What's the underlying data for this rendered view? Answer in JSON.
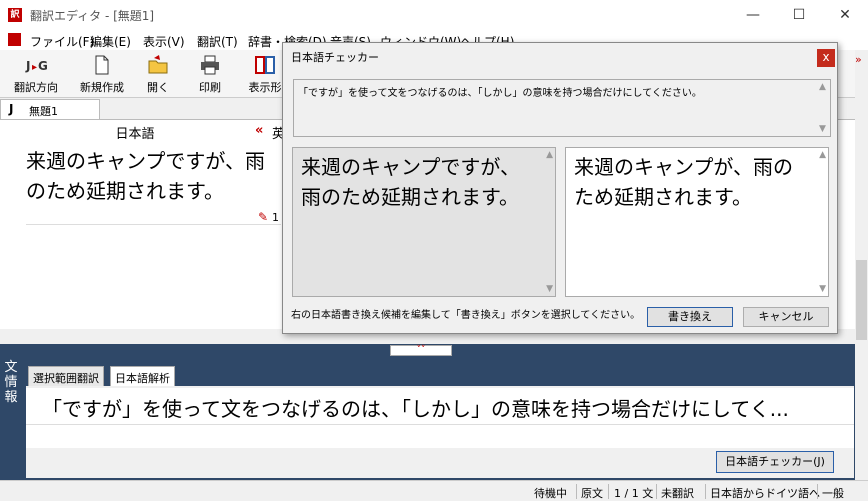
{
  "window": {
    "title": "翻訳エディタ - [無題1]",
    "controls": [
      "—",
      "☐",
      "✕"
    ]
  },
  "menu": [
    "ファイル(F)",
    "編集(E)",
    "表示(V)",
    "翻訳(T)",
    "辞書・検索(D)",
    "音声(S)",
    "ウィンドウ(W)",
    "ヘルプ(H)"
  ],
  "toolbar": [
    {
      "label": "翻訳方向",
      "icon": "J>G-icon"
    },
    {
      "label": "新規作成",
      "icon": "new-document-icon"
    },
    {
      "label": "開く",
      "icon": "open-folder-icon"
    },
    {
      "label": "印刷",
      "icon": "printer-icon"
    },
    {
      "label": "表示形",
      "icon": "layout-icon"
    }
  ],
  "document_tab": {
    "badge": "J",
    "name": "無題1"
  },
  "editor": {
    "source_header": "日本語",
    "target_header": "英",
    "source_text": "来週のキャンプですが、雨のため延期されます。",
    "sentence_number": "1"
  },
  "info_panel": {
    "side_label": "文情報",
    "tabs": [
      "選択範囲翻訳",
      "日本語解析"
    ],
    "active_tab": "日本語解析",
    "message": "「ですが」を使って文をつなげるのは、「しかし」の意味を持つ場合だけにしてく...",
    "checker_button": "日本語チェッカー(J)"
  },
  "status_bar": [
    "待機中",
    "原文",
    "1 / 1 文",
    "未翻訳",
    "日本語からドイツ語へ",
    "一般"
  ],
  "dialog": {
    "title": "日本語チェッカー",
    "close": "x",
    "message": "「ですが」を使って文をつなげるのは、「しかし」の意味を持つ場合だけにしてください。",
    "original_text": "来週のキャンプですが、雨のため延期されます。",
    "suggested_text": "来週のキャンプが、雨のため延期されます。",
    "hint": "右の日本語書き換え候補を編集して「書き換え」ボタンを選択してください。",
    "rewrite_button": "書き換え",
    "cancel_button": "キャンセル"
  },
  "colors": {
    "accent_red": "#c00000",
    "panel_navy": "#2f4868",
    "button_border_blue": "#2a5fa8"
  }
}
